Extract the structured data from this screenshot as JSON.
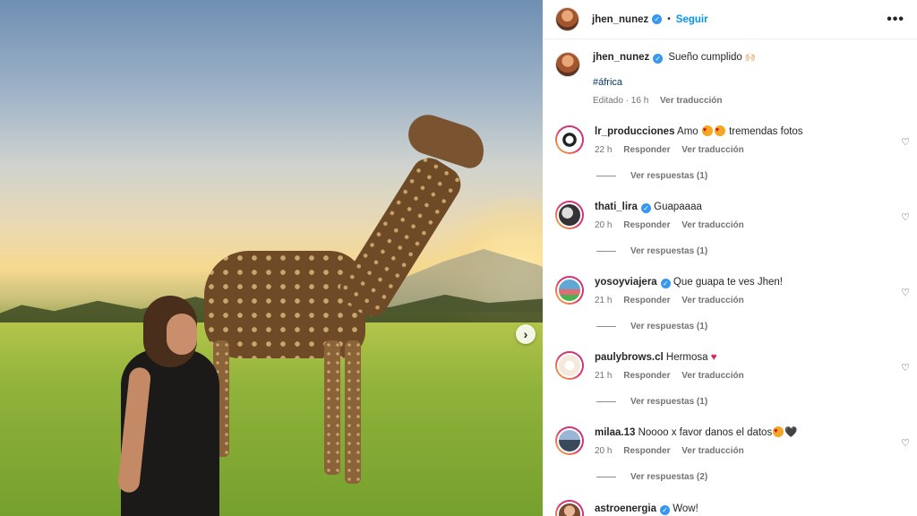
{
  "post": {
    "owner": "jhen_nunez",
    "follow_label": "Seguir",
    "more_label": "•••",
    "caption_text": "Sueño cumplido",
    "caption_emoji": "🙌🏻",
    "hashtag": "#áfrica",
    "caption_meta_time": "Editado · 16 h",
    "see_translation": "Ver traducción",
    "next_icon": "chevron-right-icon"
  },
  "comments": [
    {
      "user": "lr_producciones",
      "verified": false,
      "text": "Amo",
      "text_after": "tremendas fotos",
      "time": "22 h",
      "reply": "Responder",
      "translate": "Ver traducción",
      "replies": "Ver respuestas (1)"
    },
    {
      "user": "thati_lira",
      "verified": true,
      "text": "Guapaaaa",
      "time": "20 h",
      "reply": "Responder",
      "translate": "Ver traducción",
      "replies": "Ver respuestas (1)"
    },
    {
      "user": "yosoyviajera",
      "verified": true,
      "text": "Que guapa te ves Jhen!",
      "time": "21 h",
      "reply": "Responder",
      "translate": "Ver traducción",
      "replies": "Ver respuestas (1)"
    },
    {
      "user": "paulybrows.cl",
      "verified": false,
      "text": "Hermosa",
      "emoji": "♥",
      "time": "21 h",
      "reply": "Responder",
      "translate": "Ver traducción",
      "replies": "Ver respuestas (1)"
    },
    {
      "user": "milaa.13",
      "verified": false,
      "text": "Noooo x favor danos el datos",
      "emoji": "🖤",
      "time": "20 h",
      "reply": "Responder",
      "translate": "Ver traducción",
      "replies": "Ver respuestas (2)"
    },
    {
      "user": "astroenergia",
      "verified": true,
      "text": "Wow!"
    }
  ],
  "colors": {
    "link": "#0095f6",
    "hashtag": "#00376b",
    "verified": "#3897f0",
    "muted": "#737373"
  }
}
